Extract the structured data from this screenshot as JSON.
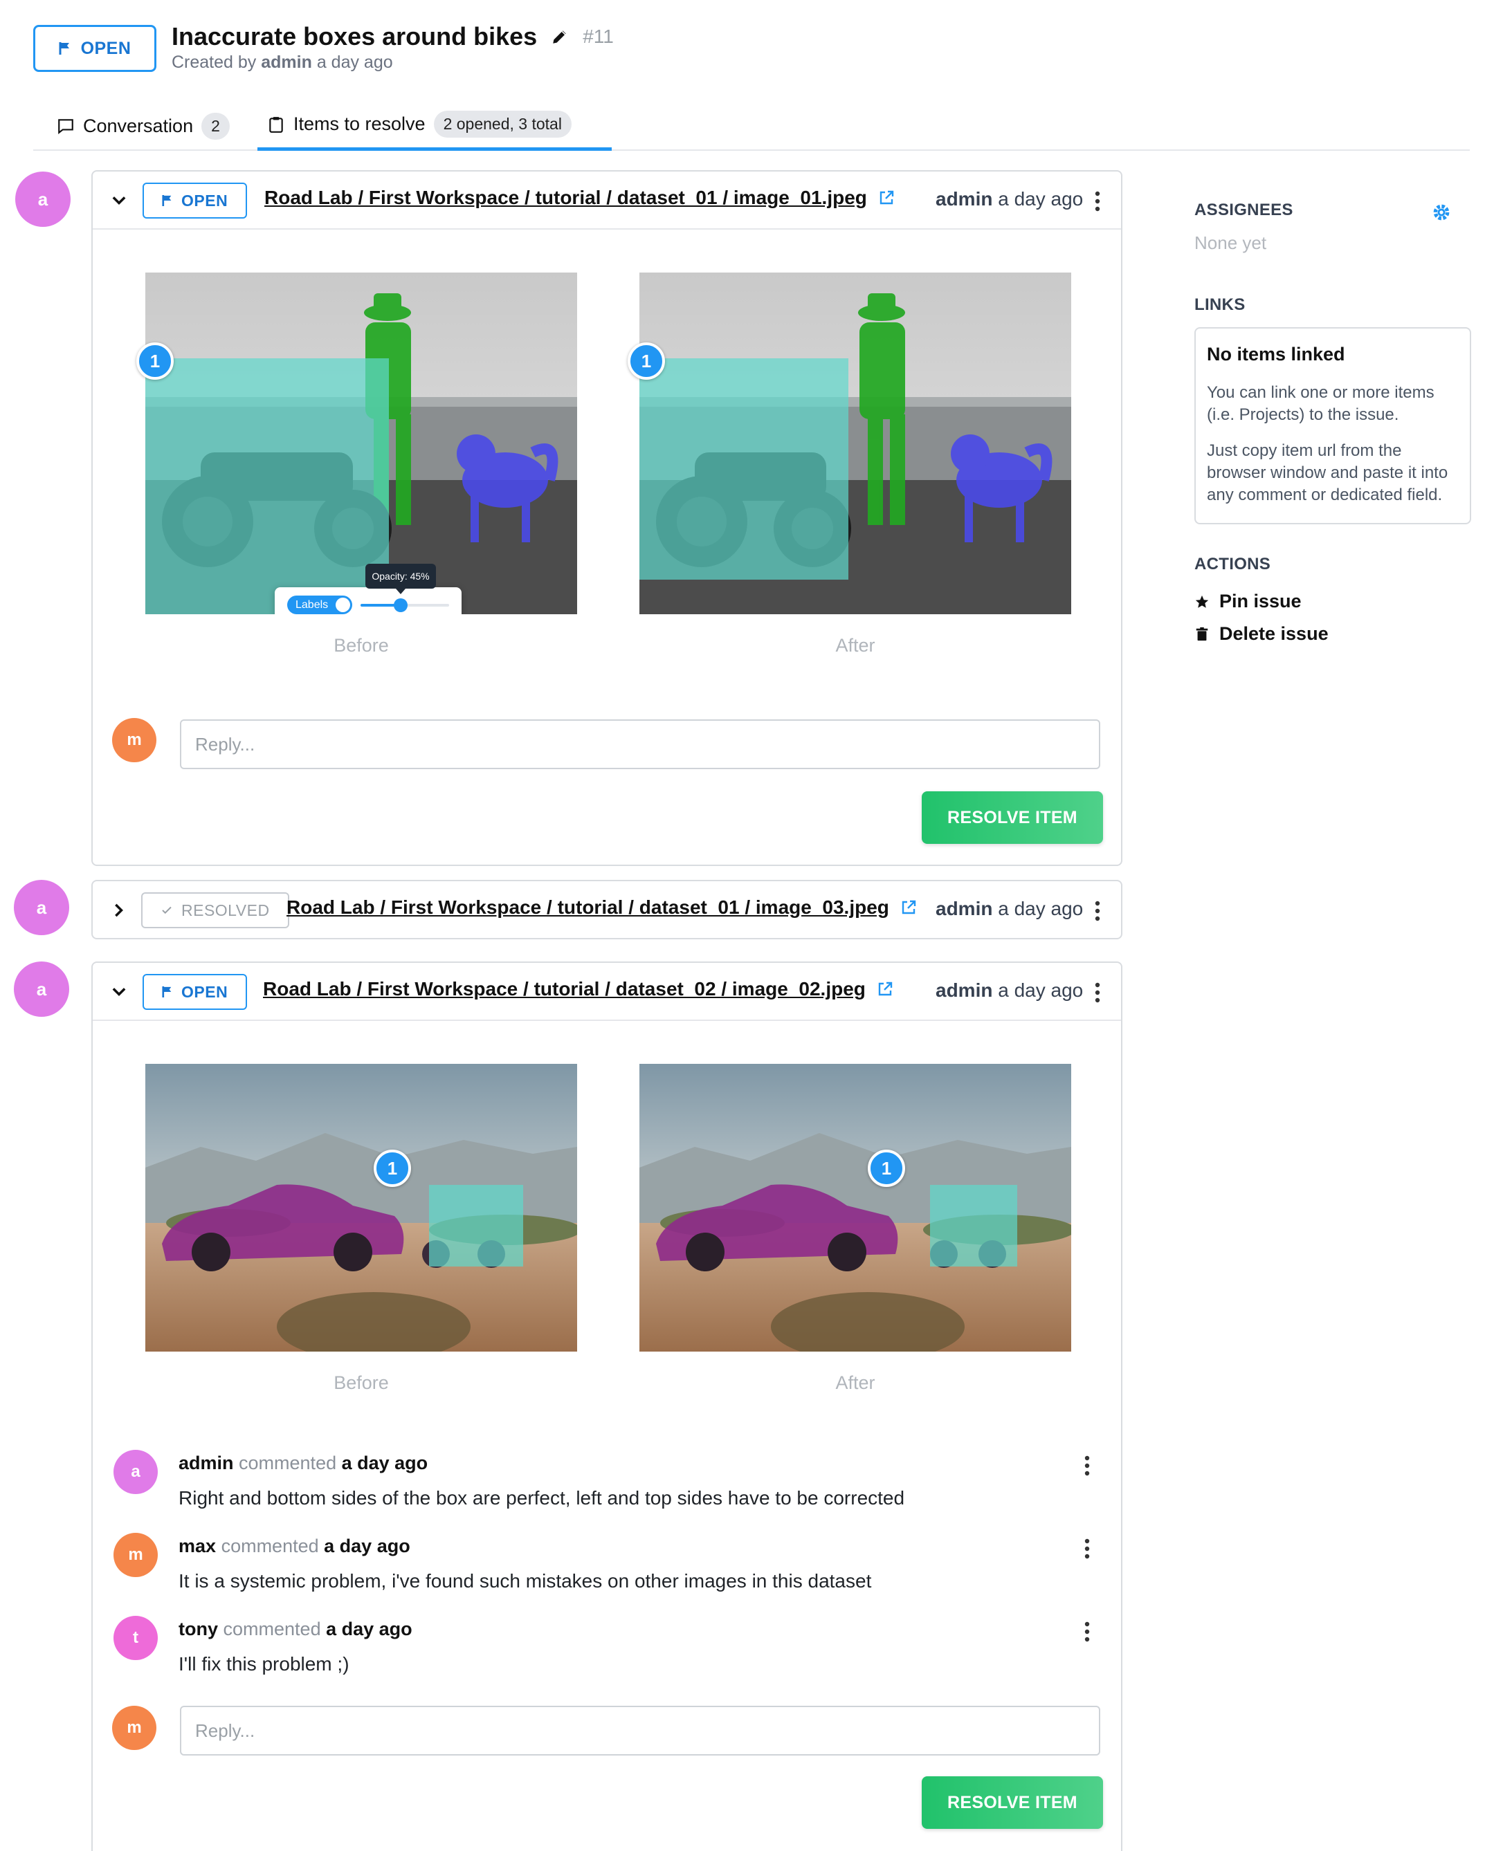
{
  "issue": {
    "status": "OPEN",
    "title": "Inaccurate boxes around bikes",
    "number": "#11",
    "created_prefix": "Created by",
    "created_by": "admin",
    "created_when": "a day ago"
  },
  "tabs": [
    {
      "label": "Conversation",
      "badge": "2"
    },
    {
      "label": "Items to resolve",
      "badge": "2 opened, 3 total"
    }
  ],
  "sidebar": {
    "assignees_heading": "ASSIGNEES",
    "assignees_empty": "None yet",
    "links_heading": "LINKS",
    "links_box_title": "No items linked",
    "links_box_p1": "You can link one or more items (i.e. Projects) to the issue.",
    "links_box_p2": "Just copy item url from the browser window and paste it into any comment or dedicated field.",
    "actions_heading": "ACTIONS",
    "actions": [
      "Pin issue",
      "Delete issue"
    ]
  },
  "items": [
    {
      "avatar": "a",
      "status": "OPEN",
      "path": "Road Lab / First Workspace / tutorial / dataset_01 / image_01.jpeg",
      "author": "admin",
      "when": "a day ago",
      "before_label": "Before",
      "after_label": "After",
      "marker": "1",
      "labels_toggle": "Labels",
      "opacity_tooltip": "Opacity: 45%",
      "opacity_value": 0.45,
      "reply_avatar": "m",
      "reply_placeholder": "Reply...",
      "resolve_label": "RESOLVE ITEM"
    },
    {
      "avatar": "a",
      "status": "RESOLVED",
      "path": "Road Lab / First Workspace / tutorial / dataset_01 / image_03.jpeg",
      "author": "admin",
      "when": "a day ago"
    },
    {
      "avatar": "a",
      "status": "OPEN",
      "path": "Road Lab / First Workspace / tutorial / dataset_02 / image_02.jpeg",
      "author": "admin",
      "when": "a day ago",
      "before_label": "Before",
      "after_label": "After",
      "marker": "1",
      "comments": [
        {
          "avatar": "a",
          "user": "admin",
          "verb": "commented",
          "when": "a day ago",
          "text": "Right and bottom sides of the box are perfect, left and top sides have to be corrected"
        },
        {
          "avatar": "m",
          "user": "max",
          "verb": "commented",
          "when": "a day ago",
          "text": "It is a systemic problem, i've found such mistakes on other images in this dataset"
        },
        {
          "avatar": "t",
          "user": "tony",
          "verb": "commented",
          "when": "a day ago",
          "text": "I'll fix this problem ;)"
        }
      ],
      "reply_avatar": "m",
      "reply_placeholder": "Reply...",
      "resolve_label": "RESOLVE ITEM"
    }
  ],
  "colors": {
    "accent": "#2196f3",
    "resolve_green": "#21c26b",
    "bike_label": "#5fd8cc",
    "person_label": "#22a822",
    "dog_label": "#4a4ae8",
    "car_label": "#8e2a8a"
  }
}
